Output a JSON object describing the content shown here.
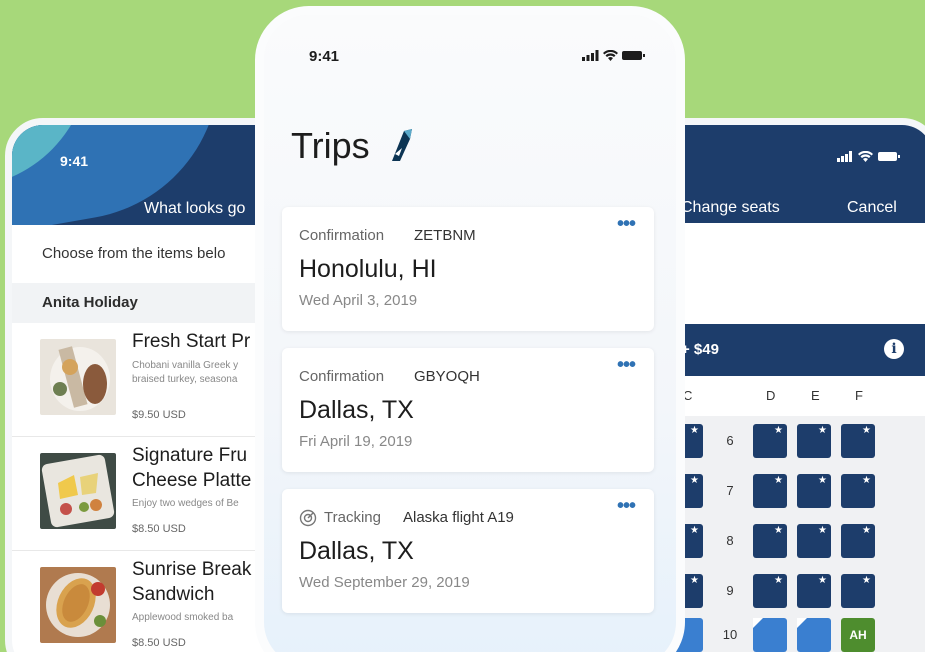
{
  "left_phone": {
    "time": "9:41",
    "header_title": "What looks go",
    "subtitle": "Choose from the items belo",
    "section": "Anita Holiday",
    "meals": [
      {
        "name_lines": [
          "Fresh Start Pr"
        ],
        "desc_lines": [
          "Chobani vanilla Greek y",
          "braised turkey, seasona"
        ],
        "price": "$9.50 USD"
      },
      {
        "name_lines": [
          "Signature Fru",
          "Cheese Platte"
        ],
        "desc_lines": [
          "Enjoy two wedges of Be"
        ],
        "price": "$8.50 USD"
      },
      {
        "name_lines": [
          "Sunrise Break",
          "Sandwich"
        ],
        "desc_lines": [
          "Applewood smoked ba"
        ],
        "price": "$8.50 USD"
      }
    ]
  },
  "center_phone": {
    "time": "9:41",
    "title": "Trips",
    "trips": [
      {
        "label": "Confirmation",
        "code": "ZETBNM",
        "city": "Honolulu, HI",
        "date": "Wed April 3, 2019",
        "more": "•••"
      },
      {
        "label": "Confirmation",
        "code": "GBYOQH",
        "city": "Dallas, TX",
        "date": "Fri April 19, 2019",
        "more": "•••"
      },
      {
        "label": "Tracking",
        "code": "Alaska flight A19",
        "city": "Dallas, TX",
        "date": "Wed September 29, 2019",
        "more": "•••",
        "icon": "target-icon"
      }
    ]
  },
  "right_phone": {
    "header_title": "Change seats",
    "cancel": "Cancel",
    "fare_label": "+ $49",
    "info": "i",
    "columns": [
      "C",
      "D",
      "E",
      "F"
    ],
    "rows": [
      "6",
      "7",
      "8",
      "9",
      "10"
    ],
    "special_seat": "AH"
  },
  "colors": {
    "background": "#a7d87a",
    "navy": "#1d3d6b",
    "selected_seat": "#3a7fd0",
    "assigned_seat": "#4e8d2e",
    "accent": "#2f72b4"
  }
}
